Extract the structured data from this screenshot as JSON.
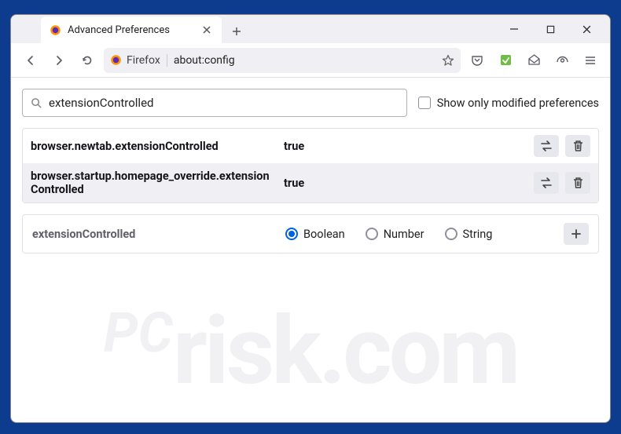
{
  "tab": {
    "title": "Advanced Preferences"
  },
  "urlbar": {
    "brand": "Firefox",
    "url": "about:config"
  },
  "search": {
    "value": "extensionControlled"
  },
  "show_modified_label": "Show only modified preferences",
  "prefs": [
    {
      "name": "browser.newtab.extensionControlled",
      "value": "true"
    },
    {
      "name": "browser.startup.homepage_override.extensionControlled",
      "value": "true"
    }
  ],
  "add": {
    "name": "extensionControlled",
    "types": [
      "Boolean",
      "Number",
      "String"
    ],
    "selected": "Boolean"
  }
}
